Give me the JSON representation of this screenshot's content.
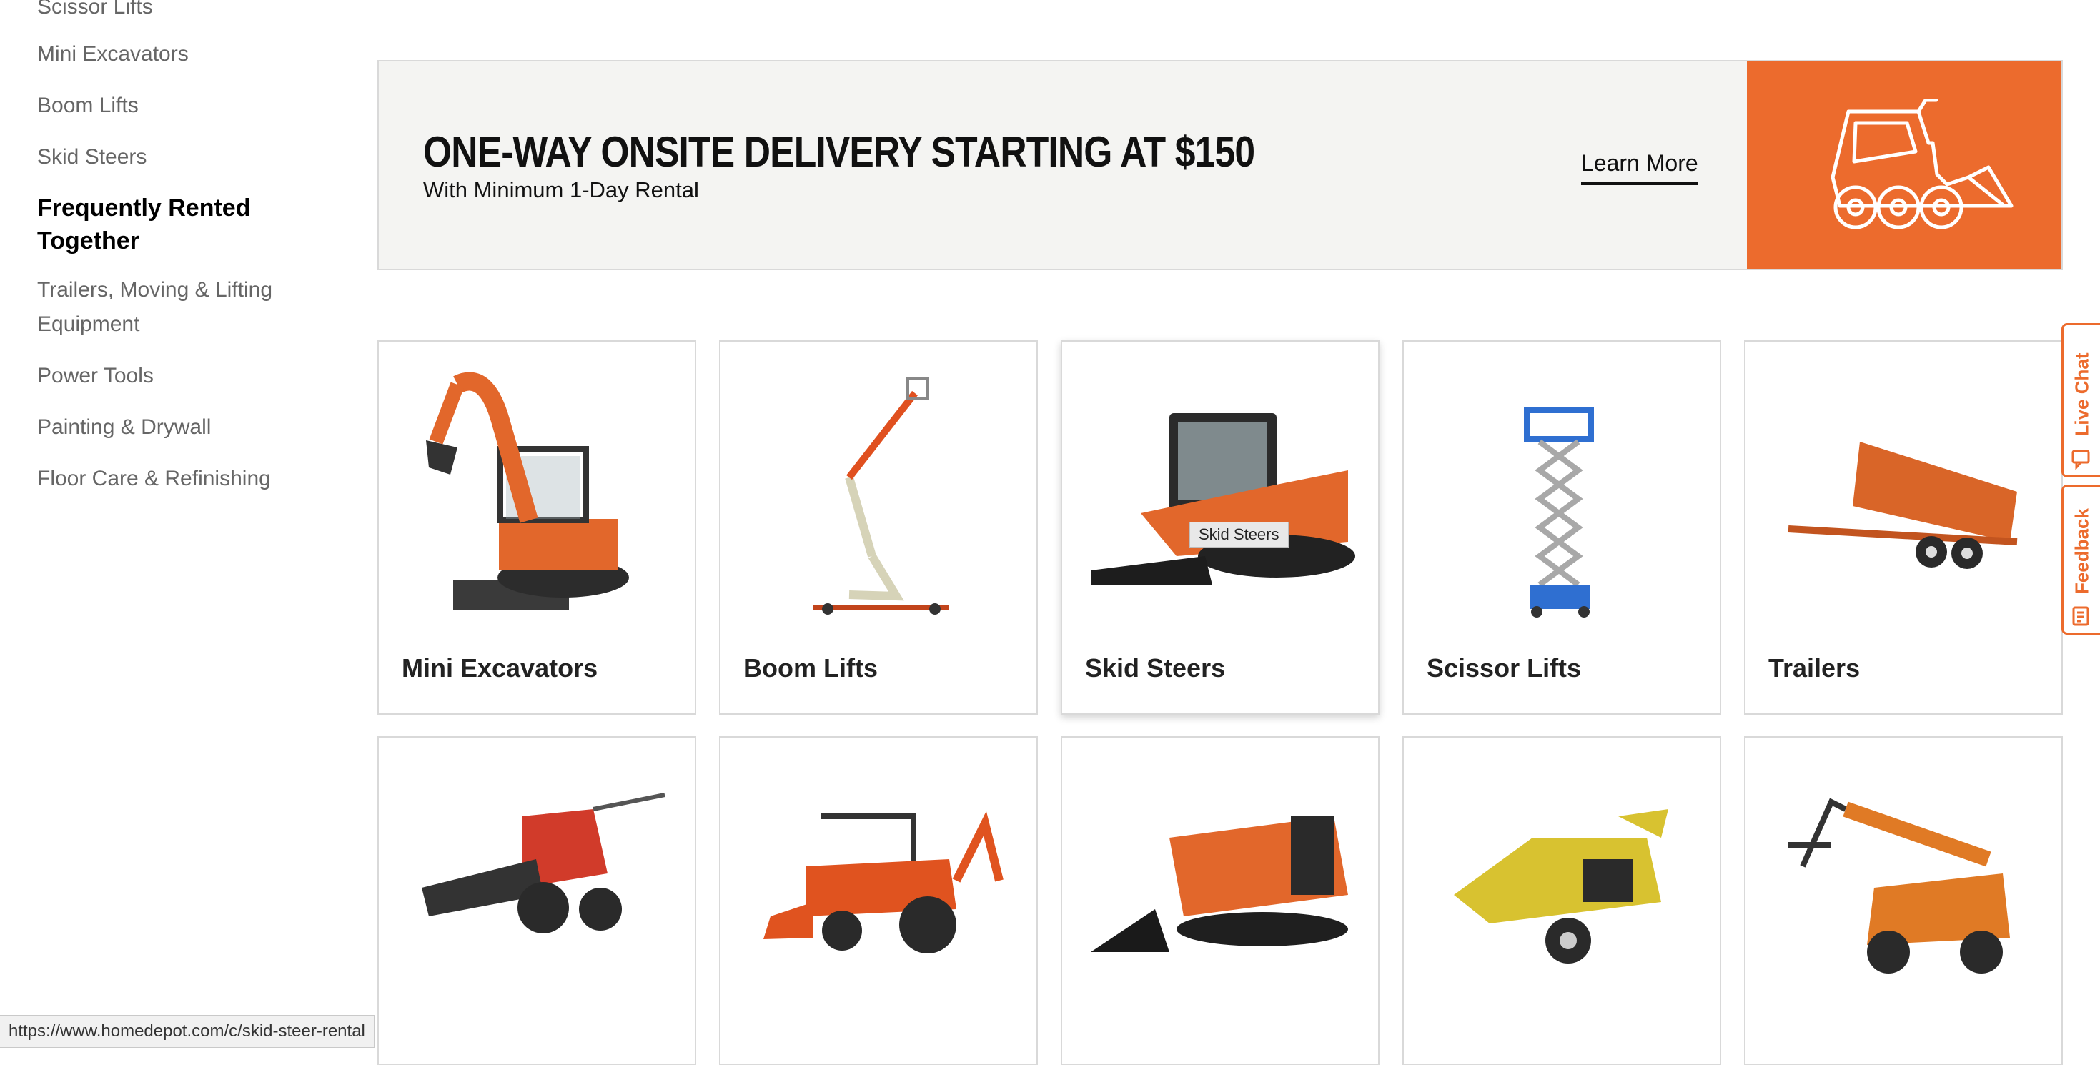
{
  "sidebar": {
    "links_top": [
      "Scissor Lifts",
      "Mini Excavators",
      "Boom Lifts",
      "Skid Steers"
    ],
    "heading": "Frequently Rented Together",
    "links_bottom": [
      "Trailers, Moving & Lifting Equipment",
      "Power Tools",
      "Painting & Drywall",
      "Floor Care & Refinishing"
    ]
  },
  "banner": {
    "title": "ONE-WAY ONSITE DELIVERY STARTING AT $150",
    "subtitle": "With Minimum 1-Day Rental",
    "cta": "Learn More",
    "accent_color": "#ec6b2d",
    "icon": "skid-steer-icon"
  },
  "tiles_row1": [
    {
      "label": "Mini Excavators",
      "icon": "mini-excavator-image"
    },
    {
      "label": "Boom Lifts",
      "icon": "boom-lift-image"
    },
    {
      "label": "Skid Steers",
      "icon": "skid-steer-image"
    },
    {
      "label": "Scissor Lifts",
      "icon": "scissor-lift-image"
    },
    {
      "label": "Trailers",
      "icon": "trailer-image"
    }
  ],
  "tiles_row2": [
    {
      "icon": "trencher-image"
    },
    {
      "icon": "tractor-backhoe-image"
    },
    {
      "icon": "mini-track-loader-image"
    },
    {
      "icon": "wood-chipper-image"
    },
    {
      "icon": "telehandler-image"
    }
  ],
  "tooltip": "Skid Steers",
  "side_tabs": {
    "live_chat": "Live Chat",
    "feedback": "Feedback"
  },
  "status_url": "https://www.homedepot.com/c/skid-steer-rental"
}
